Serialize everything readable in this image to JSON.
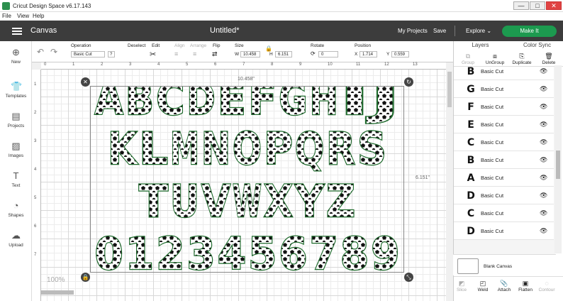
{
  "window": {
    "title": "Cricut Design Space  v6.17.143",
    "controls": [
      "—",
      "□",
      "✕"
    ]
  },
  "menu": [
    "File",
    "View",
    "Help"
  ],
  "header": {
    "section": "Canvas",
    "project_title": "Untitled*",
    "my_projects": "My Projects",
    "save": "Save",
    "machine": "Explore",
    "machine_arrow": "⌄",
    "make_it": "Make It"
  },
  "leftbar": [
    {
      "label": "New",
      "icon": "plus-icon",
      "glyph": "⊕"
    },
    {
      "label": "Templates",
      "icon": "shirt-icon",
      "glyph": "👕"
    },
    {
      "label": "Projects",
      "icon": "projects-icon",
      "glyph": "▤"
    },
    {
      "label": "Images",
      "icon": "image-icon",
      "glyph": "▨"
    },
    {
      "label": "Text",
      "icon": "text-icon",
      "glyph": "T"
    },
    {
      "label": "Shapes",
      "icon": "shapes-icon",
      "glyph": "◔"
    },
    {
      "label": "Upload",
      "icon": "upload-icon",
      "glyph": "☁"
    }
  ],
  "toolbar": {
    "undo": "↶",
    "redo": "↷",
    "operation_label": "Operation",
    "operation_value": "Basic Cut",
    "operation_help": "?",
    "deselect": "Deselect",
    "edit": "Edit",
    "align": "Align",
    "arrange": "Arrange",
    "flip": "Flip",
    "size": "Size",
    "w_label": "W",
    "w_value": "10.458",
    "h_label": "H",
    "h_value": "6.151",
    "rotate": "Rotate",
    "rotate_value": "0",
    "position": "Position",
    "x_label": "X",
    "x_value": "1.714",
    "y_label": "Y",
    "y_value": "0.559"
  },
  "ruler_top": [
    "0",
    "1",
    "2",
    "3",
    "4",
    "5",
    "6",
    "7",
    "8",
    "9",
    "10",
    "11",
    "12",
    "13"
  ],
  "ruler_left": [
    "1",
    "2",
    "3",
    "4",
    "5",
    "6",
    "7"
  ],
  "canvas": {
    "zoom": "100%",
    "width_dim": "10.458\"",
    "height_dim": "6.151\"",
    "rows": [
      "ABCDEFGHIJ",
      "KLMNOPQRS",
      "TUVWXYZ",
      "0123456789"
    ],
    "accent": "#1f6b2d"
  },
  "layers_panel": {
    "tabs": [
      "Layers",
      "Color Sync"
    ],
    "tools": [
      {
        "label": "Group",
        "icon": "group-icon"
      },
      {
        "label": "UnGroup",
        "icon": "ungroup-icon"
      },
      {
        "label": "Duplicate",
        "icon": "duplicate-icon"
      },
      {
        "label": "Delete",
        "icon": "trash-icon"
      }
    ],
    "layers": [
      {
        "glyph": "B",
        "label": "Basic Cut"
      },
      {
        "glyph": "G",
        "label": "Basic Cut"
      },
      {
        "glyph": "F",
        "label": "Basic Cut"
      },
      {
        "glyph": "E",
        "label": "Basic Cut"
      },
      {
        "glyph": "C",
        "label": "Basic Cut"
      },
      {
        "glyph": "B",
        "label": "Basic Cut"
      },
      {
        "glyph": "A",
        "label": "Basic Cut"
      },
      {
        "glyph": "D",
        "label": "Basic Cut"
      },
      {
        "glyph": "C",
        "label": "Basic Cut"
      },
      {
        "glyph": "D",
        "label": "Basic Cut"
      }
    ],
    "blank_canvas": "Blank Canvas",
    "bottom_tools": [
      {
        "label": "Slice",
        "icon": "slice-icon"
      },
      {
        "label": "Weld",
        "icon": "weld-icon"
      },
      {
        "label": "Attach",
        "icon": "attach-icon"
      },
      {
        "label": "Flatten",
        "icon": "flatten-icon"
      },
      {
        "label": "Contour",
        "icon": "contour-icon"
      }
    ]
  }
}
